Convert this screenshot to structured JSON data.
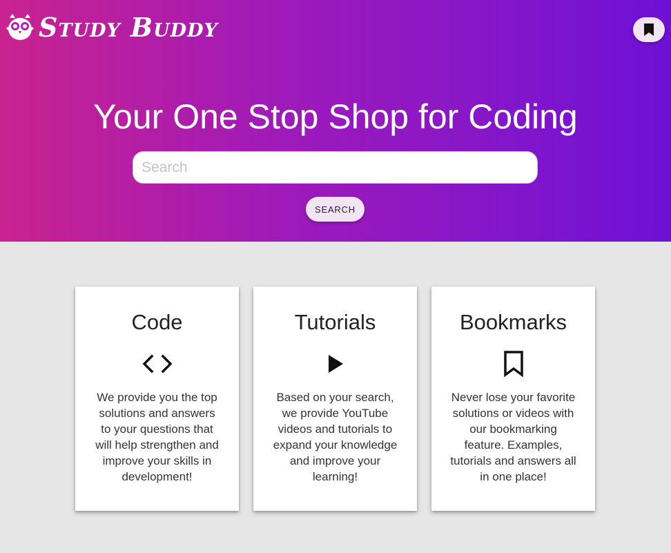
{
  "header": {
    "brand": "Study Buddy"
  },
  "hero": {
    "title": "Your One Stop Shop for Coding",
    "search_placeholder": "Search",
    "search_button": "SEARCH"
  },
  "cards": [
    {
      "title": "Code",
      "icon": "code-icon",
      "description": "We provide you the top solutions and answers to your questions that will help strengthen and improve your skills in development!"
    },
    {
      "title": "Tutorials",
      "icon": "play-icon",
      "description": "Based on your search, we provide YouTube videos and tutorials to expand your knowledge and improve your learning!"
    },
    {
      "title": "Bookmarks",
      "icon": "bookmark-outline-icon",
      "description": "Never lose your favorite solutions or videos with our bookmarking feature. Examples, tutorials and answers all in one place!"
    }
  ],
  "colors": {
    "gradient_start": "#c9238f",
    "gradient_end": "#6e10d6",
    "button_bg": "#f2e4f4",
    "page_bg": "#e6e6e6"
  }
}
